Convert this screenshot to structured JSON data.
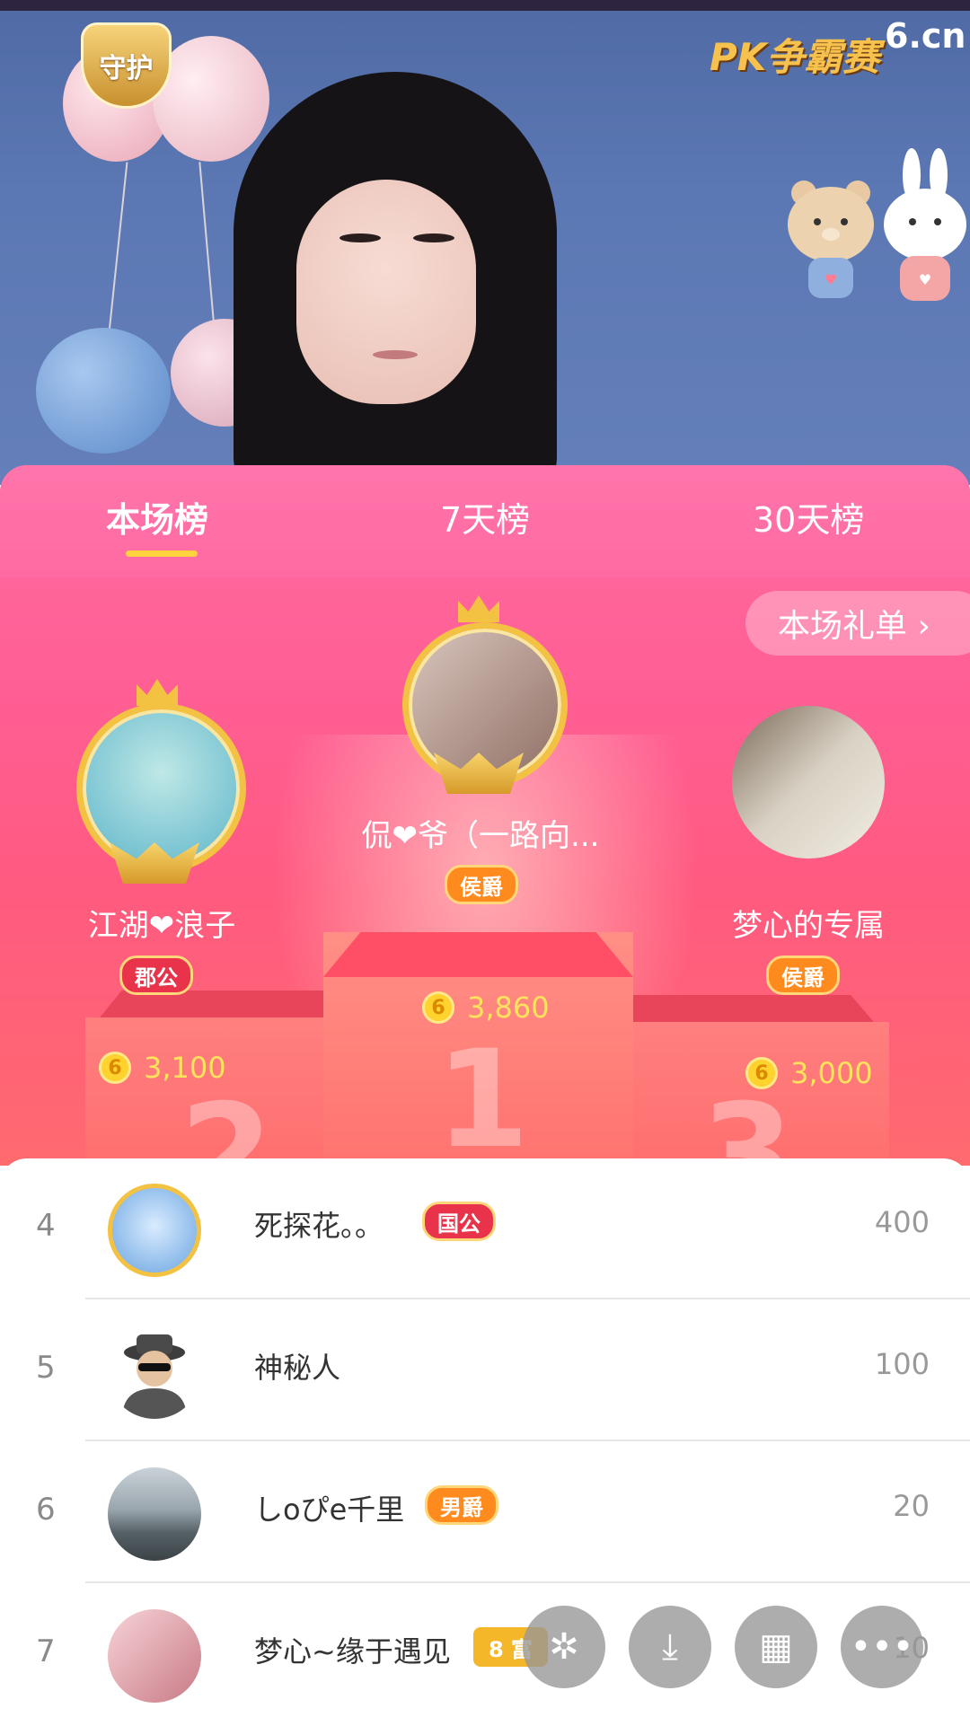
{
  "stream": {
    "guard_badge": "守护",
    "pk_badge": "PK争霸赛",
    "brand": "6.cn"
  },
  "tabs": [
    {
      "label": "本场榜",
      "active": true
    },
    {
      "label": "7天榜",
      "active": false
    },
    {
      "label": "30天榜",
      "active": false
    }
  ],
  "gift_list_button": "本场礼单 ›",
  "podium": {
    "first": {
      "name": "侃❤爷（一路向...",
      "rank_title": "侯爵",
      "score": "3,860",
      "podium_number": "1"
    },
    "second": {
      "name": "江湖❤浪子",
      "rank_title": "郡公",
      "score": "3,100",
      "podium_number": "2"
    },
    "third": {
      "name": "梦心的专属",
      "rank_title": "侯爵",
      "score": "3,000",
      "podium_number": "3"
    },
    "coin_symbol": "6"
  },
  "list": [
    {
      "rank": "4",
      "name": "死探花。。",
      "badge": "国公",
      "score": "400"
    },
    {
      "rank": "5",
      "name": "神秘人",
      "badge": "",
      "score": "100"
    },
    {
      "rank": "6",
      "name": "しoぴe千里",
      "badge": "男爵",
      "score": "20"
    },
    {
      "rank": "7",
      "name": "梦心~缘于遇见",
      "badge": "8 富",
      "score": "10"
    }
  ],
  "fab_buttons": [
    {
      "icon": "sparkle-icon",
      "glyph": "✲"
    },
    {
      "icon": "download-icon",
      "glyph": "⤓"
    },
    {
      "icon": "grid-icon",
      "glyph": "▦"
    },
    {
      "icon": "more-icon",
      "glyph": "•••"
    }
  ],
  "colors": {
    "panel_pink": "#ff5e93",
    "tab_underline": "#ffd33d",
    "coin_gold": "#ffd22e",
    "badge_red": "#e8334a",
    "badge_orange": "#ff8a1e"
  }
}
